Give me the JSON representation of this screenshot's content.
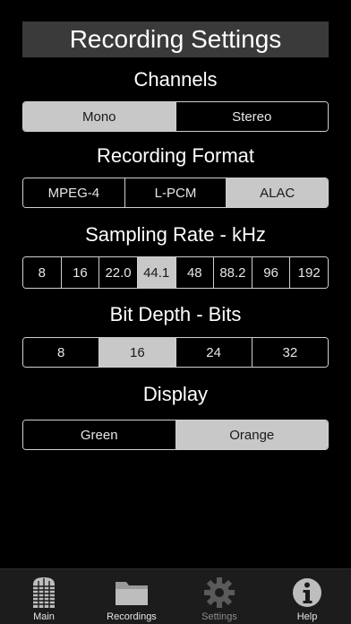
{
  "title": "Recording Settings",
  "sections": {
    "channels": {
      "label": "Channels",
      "options": [
        "Mono",
        "Stereo"
      ],
      "selected": "Mono"
    },
    "format": {
      "label": "Recording Format",
      "options": [
        "MPEG-4",
        "L-PCM",
        "ALAC"
      ],
      "selected": "ALAC"
    },
    "sampling": {
      "label": "Sampling Rate - kHz",
      "options": [
        "8",
        "16",
        "22.0",
        "44.1",
        "48",
        "88.2",
        "96",
        "192"
      ],
      "selected": "44.1"
    },
    "bitdepth": {
      "label": "Bit Depth - Bits",
      "options": [
        "8",
        "16",
        "24",
        "32"
      ],
      "selected": "16"
    },
    "display": {
      "label": "Display",
      "options": [
        "Green",
        "Orange"
      ],
      "selected": "Orange"
    }
  },
  "tabs": [
    {
      "label": "Main",
      "icon": "microphone-icon"
    },
    {
      "label": "Recordings",
      "icon": "folder-icon"
    },
    {
      "label": "Settings",
      "icon": "gear-icon",
      "active": true
    },
    {
      "label": "Help",
      "icon": "info-icon"
    }
  ]
}
